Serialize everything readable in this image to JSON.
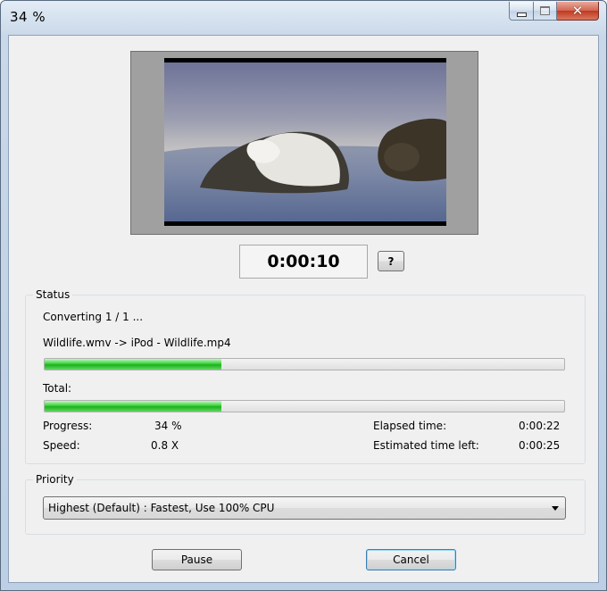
{
  "window": {
    "title": "34 %"
  },
  "preview": {
    "timecode": "0:00:10",
    "help_label": "?"
  },
  "status": {
    "group_label": "Status",
    "converting_text": "Converting 1 / 1 ...",
    "file_text": "Wildlife.wmv -> iPod - Wildlife.mp4",
    "file_progress": 0.34,
    "total_label": "Total:",
    "total_progress": 0.34,
    "progress_label": "Progress:",
    "progress_value": "34 %",
    "speed_label": "Speed:",
    "speed_value": "0.8 X",
    "elapsed_label": "Elapsed time:",
    "elapsed_value": "0:00:22",
    "remaining_label": "Estimated time left:",
    "remaining_value": "0:00:25"
  },
  "priority": {
    "group_label": "Priority",
    "selected": "Highest (Default) : Fastest, Use 100% CPU"
  },
  "buttons": {
    "pause": "Pause",
    "cancel": "Cancel"
  },
  "icons": {
    "minimize": "minimize-icon",
    "maximize": "maximize-icon",
    "close": "close-icon",
    "dropdown": "chevron-down-icon"
  },
  "colors": {
    "progress_fill": "#28c428",
    "close_button": "#c7412a"
  }
}
